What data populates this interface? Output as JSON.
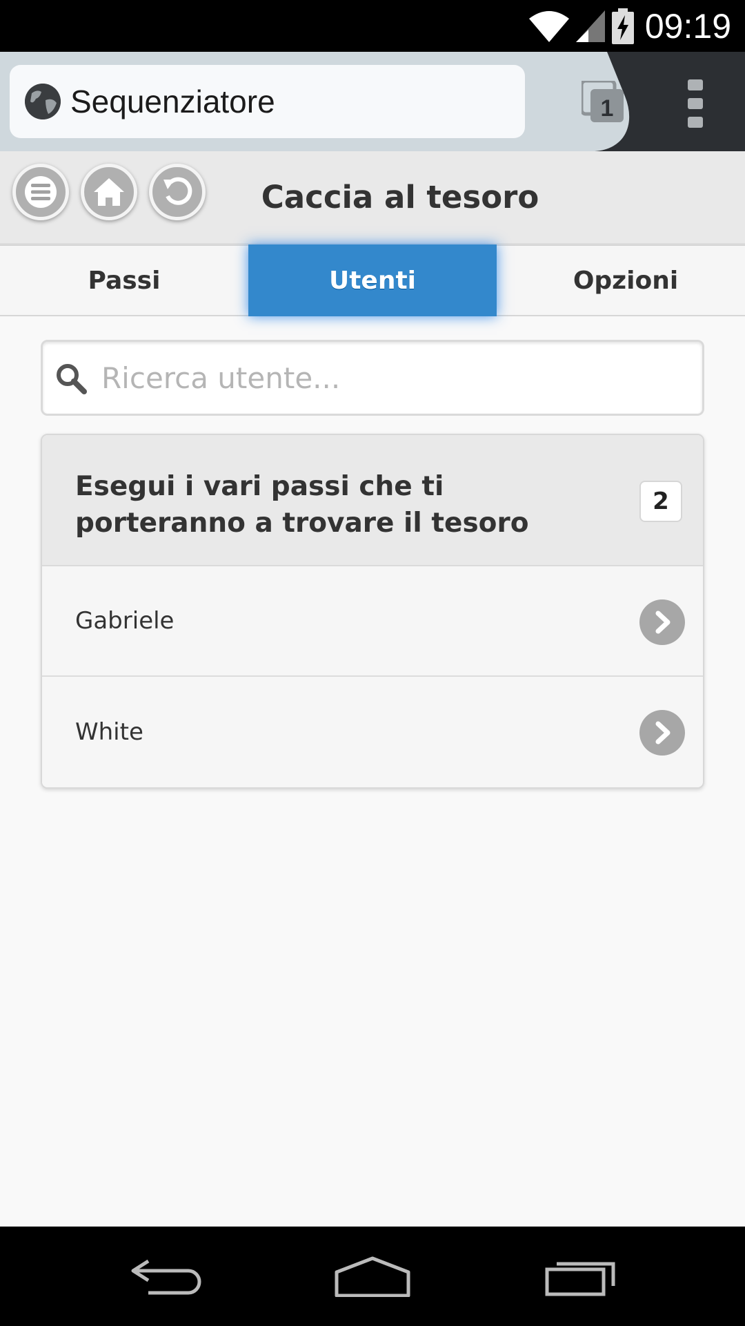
{
  "status_bar": {
    "time": "09:19",
    "icons": [
      "wifi-icon",
      "signal-icon",
      "battery-charging-icon"
    ]
  },
  "browser": {
    "url_title": "Sequenziatore",
    "tab_count": "1",
    "icons": [
      "globe-icon",
      "tabs-icon",
      "overflow-menu-icon"
    ]
  },
  "header": {
    "title": "Caccia al tesoro",
    "buttons": [
      "menu-icon",
      "home-icon",
      "back-icon"
    ]
  },
  "nav": {
    "tabs": [
      {
        "label": "Passi",
        "active": false
      },
      {
        "label": "Utenti",
        "active": true
      },
      {
        "label": "Opzioni",
        "active": false
      }
    ]
  },
  "search": {
    "placeholder": "Ricerca utente...",
    "value": ""
  },
  "list": {
    "divider_text": "Esegui i vari passi che ti porteranno a trovare il tesoro",
    "count": "2",
    "items": [
      {
        "label": "Gabriele"
      },
      {
        "label": "White"
      }
    ]
  },
  "colors": {
    "accent": "#3388cc",
    "status_bar": "#000000",
    "toolbar": "#2c2f33"
  }
}
